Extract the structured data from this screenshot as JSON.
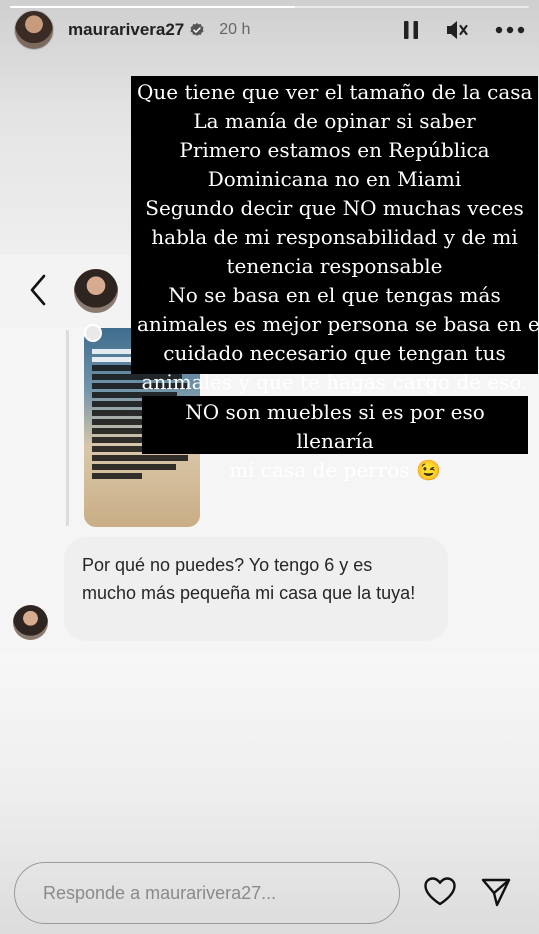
{
  "header": {
    "username": "maurarivera27",
    "time": "20 h"
  },
  "progress": {
    "fraction": 0.55
  },
  "overlay_main": {
    "lines": [
      "Que tiene que ver el tamaño de la casa ?",
      "La manía de opinar si saber",
      "Primero estamos en República",
      "Dominicana no en Miami",
      "Segundo decir que NO muchas veces",
      "habla de mi responsabilidad y de mi",
      "tenencia responsable",
      "No se basa en el que tengas más",
      "animales es mejor persona se basa en el",
      "cuidado necesario que tengan tus",
      "animales y que te hagas cargo de eso."
    ]
  },
  "overlay_secondary": {
    "lines": [
      "NO son muebles si es por eso llenaría",
      "mi casa de perros 😉"
    ]
  },
  "dm": {
    "message": "Por qué no puedes?   Yo tengo 6 y es mucho más pequeña mi casa que la tuya!"
  },
  "reply": {
    "placeholder": "Responde a maurarivera27..."
  },
  "icons": {
    "verified": "verified-badge-icon",
    "pause": "pause-icon",
    "mute": "speaker-muted-icon",
    "more": "more-options-icon",
    "back": "back-chevron-icon",
    "like": "heart-icon",
    "send": "send-icon"
  },
  "colors": {
    "overlay_bg": "#000000",
    "overlay_text": "#ffffff",
    "bubble_bg": "#efefef"
  }
}
